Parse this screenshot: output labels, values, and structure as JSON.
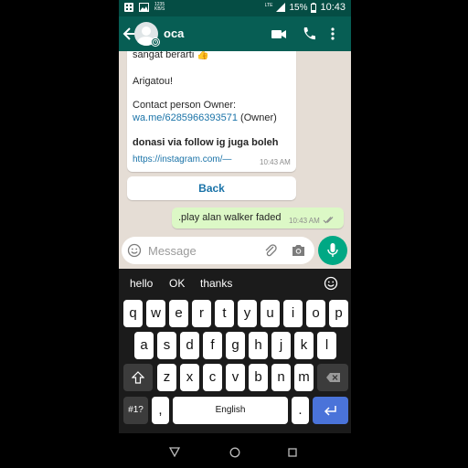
{
  "status_bar": {
    "speed_value": "1235",
    "speed_unit": "KB/S",
    "network": "LTE",
    "battery": "15%",
    "time": "10:43"
  },
  "toolbar": {
    "contact_name": "oca"
  },
  "messages": {
    "incoming": {
      "line1": "sangat berarti 👍",
      "line2": "Arigatou!",
      "line3": "Contact person Owner:",
      "link1": "wa.me/6285966393571",
      "link1_suffix": " (Owner)",
      "bold_line": "donasi via follow ig juga boleh",
      "link2": "https://instagram.com/—",
      "time": "10:43 AM"
    },
    "button_label": "Back",
    "outgoing": {
      "text": ".play alan walker faded",
      "time": "10:43 AM"
    }
  },
  "input_bar": {
    "placeholder": "Message"
  },
  "keyboard": {
    "suggestions": [
      "hello",
      "OK",
      "thanks"
    ],
    "row1": [
      "q",
      "w",
      "e",
      "r",
      "t",
      "y",
      "u",
      "i",
      "o",
      "p"
    ],
    "row2": [
      "a",
      "s",
      "d",
      "f",
      "g",
      "h",
      "j",
      "k",
      "l"
    ],
    "row3": [
      "z",
      "x",
      "c",
      "v",
      "b",
      "n",
      "m"
    ],
    "symbols_label": "#1?",
    "comma": ",",
    "space_label": "English",
    "period": "."
  },
  "colors": {
    "header": "#075e54",
    "status_bar": "#054d44",
    "chat_bg": "#e5ddd5",
    "outgoing_bubble": "#dcf8c6",
    "link": "#1a73a8",
    "mic_button": "#00a884",
    "enter_key": "#4a73d9"
  }
}
